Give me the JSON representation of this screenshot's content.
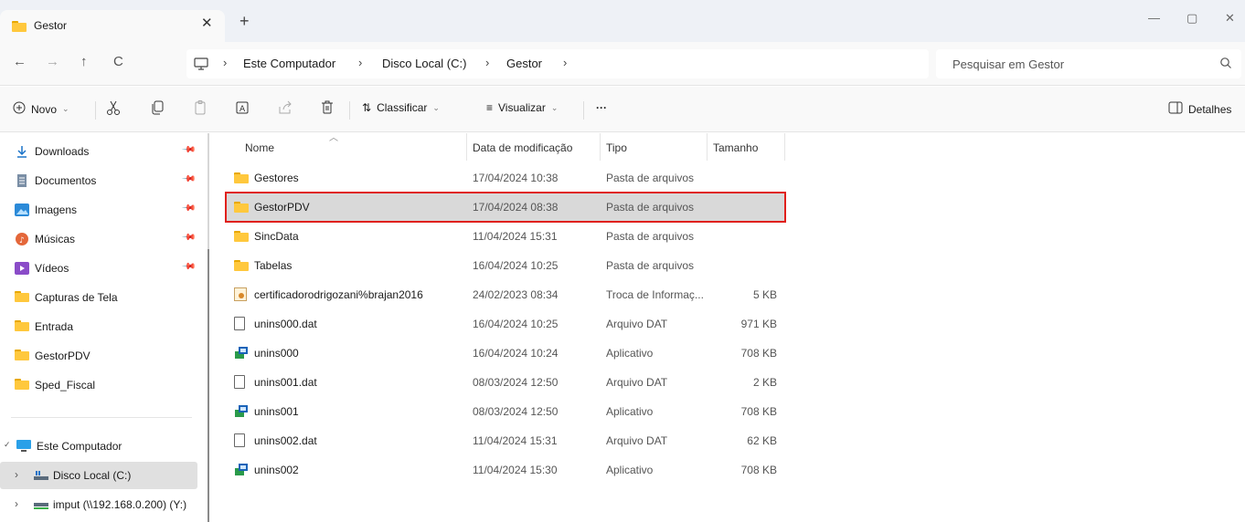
{
  "window": {
    "tab_title": "Gestor",
    "tab_close": "✕",
    "new_tab": "+",
    "controls": {
      "minimize": "—",
      "maximize": "▢",
      "close": "✕"
    }
  },
  "address_bar": {
    "back": "←",
    "forward": "→",
    "up": "↑",
    "refresh": "C",
    "breadcrumbs": [
      "Este Computador",
      "Disco Local (C:)",
      "Gestor"
    ],
    "separator": "›",
    "search_placeholder": "Pesquisar em Gestor"
  },
  "command_bar": {
    "new_label": "Novo",
    "sort_label": "Classificar",
    "view_label": "Visualizar",
    "more_label": "···",
    "details_label": "Detalhes",
    "icons": [
      "cut-icon",
      "copy-icon",
      "paste-icon",
      "rename-icon",
      "share-icon",
      "delete-icon"
    ]
  },
  "sidebar": {
    "quick_access": [
      {
        "label": "Downloads",
        "icon": "download-icon",
        "pinned": true
      },
      {
        "label": "Documentos",
        "icon": "document-icon",
        "pinned": true
      },
      {
        "label": "Imagens",
        "icon": "pictures-icon",
        "pinned": true
      },
      {
        "label": "Músicas",
        "icon": "music-icon",
        "pinned": true
      },
      {
        "label": "Vídeos",
        "icon": "video-icon",
        "pinned": true
      },
      {
        "label": "Capturas de Tela",
        "icon": "folder-icon",
        "pinned": false
      },
      {
        "label": "Entrada",
        "icon": "folder-icon",
        "pinned": false
      },
      {
        "label": "GestorPDV",
        "icon": "folder-icon",
        "pinned": false
      },
      {
        "label": "Sped_Fiscal",
        "icon": "folder-icon",
        "pinned": false
      }
    ],
    "this_pc": {
      "label": "Este Computador",
      "expand": "✓"
    },
    "drives": [
      {
        "label": "Disco Local (C:)",
        "expand": "›",
        "selected": true
      },
      {
        "label": "imput (\\\\192.168.0.200) (Y:)",
        "expand": "›",
        "selected": false
      }
    ]
  },
  "file_list": {
    "columns": [
      "Nome",
      "Data de modificação",
      "Tipo",
      "Tamanho"
    ],
    "rows": [
      {
        "name": "Gestores",
        "date": "17/04/2024 10:38",
        "type": "Pasta de arquivos",
        "size": "",
        "icon": "folder-icon"
      },
      {
        "name": "GestorPDV",
        "date": "17/04/2024 08:38",
        "type": "Pasta de arquivos",
        "size": "",
        "icon": "folder-icon",
        "selected": true
      },
      {
        "name": "SincData",
        "date": "11/04/2024 15:31",
        "type": "Pasta de arquivos",
        "size": "",
        "icon": "folder-icon"
      },
      {
        "name": "Tabelas",
        "date": "16/04/2024 10:25",
        "type": "Pasta de arquivos",
        "size": "",
        "icon": "folder-icon"
      },
      {
        "name": "certificadorodrigozani%brajan2016",
        "date": "24/02/2023 08:34",
        "type": "Troca de Informaç...",
        "size": "5 KB",
        "icon": "certificate-icon"
      },
      {
        "name": "unins000.dat",
        "date": "16/04/2024 10:25",
        "type": "Arquivo DAT",
        "size": "971 KB",
        "icon": "file-icon"
      },
      {
        "name": "unins000",
        "date": "16/04/2024 10:24",
        "type": "Aplicativo",
        "size": "708 KB",
        "icon": "application-icon"
      },
      {
        "name": "unins001.dat",
        "date": "08/03/2024 12:50",
        "type": "Arquivo DAT",
        "size": "2 KB",
        "icon": "file-icon"
      },
      {
        "name": "unins001",
        "date": "08/03/2024 12:50",
        "type": "Aplicativo",
        "size": "708 KB",
        "icon": "application-icon"
      },
      {
        "name": "unins002.dat",
        "date": "11/04/2024 15:31",
        "type": "Arquivo DAT",
        "size": "62 KB",
        "icon": "file-icon"
      },
      {
        "name": "unins002",
        "date": "11/04/2024 15:30",
        "type": "Aplicativo",
        "size": "708 KB",
        "icon": "application-icon"
      }
    ]
  },
  "colors": {
    "folder": "#ffc83d",
    "selection_outline": "#e0201c",
    "selection_bg": "#d9d9d9"
  }
}
